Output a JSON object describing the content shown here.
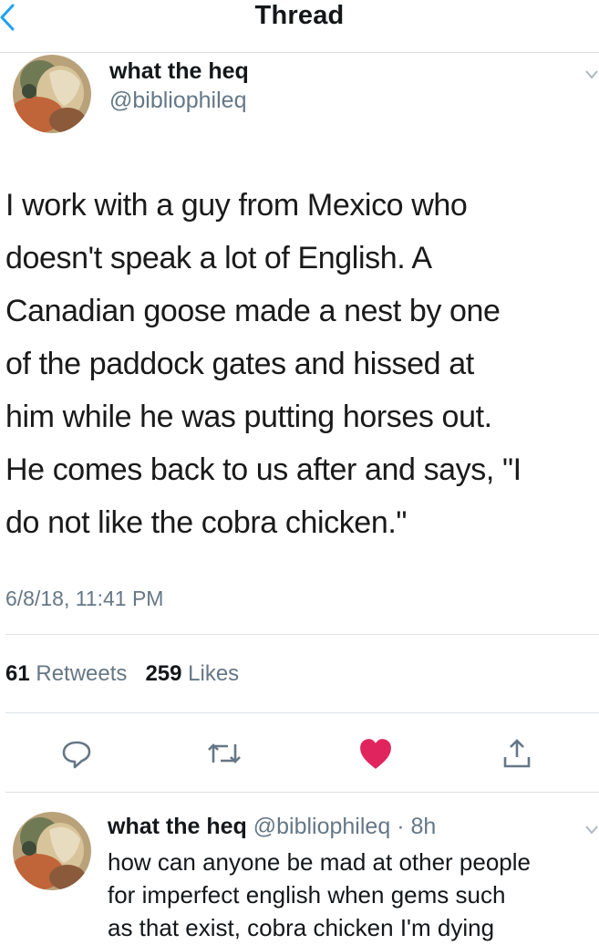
{
  "header": {
    "title": "Thread"
  },
  "tweet": {
    "name": "what the heq",
    "handle": "@bibliophileq",
    "body_lines": [
      "I work with a guy from Mexico who",
      "doesn't speak a lot of English. A",
      "Canadian goose made a nest by one",
      "of the paddock gates and hissed at",
      "him while he was putting horses out.",
      "He comes back to us after and says, \"I",
      "do not like the cobra chicken.\""
    ],
    "timestamp": "6/8/18, 11:41 PM",
    "retweets_count": "61",
    "retweets_label": "Retweets",
    "likes_count": "259",
    "likes_label": "Likes"
  },
  "actions": {
    "reply_icon": "reply-icon",
    "retweet_icon": "retweet-icon",
    "like_icon": "heart-icon",
    "share_icon": "share-icon",
    "like_color": "#e0245e",
    "icon_color": "#657786"
  },
  "reply": {
    "name": "what the heq",
    "handle": "@bibliophileq",
    "separator": "·",
    "time": "8h",
    "lines": [
      "how can anyone be mad at other people",
      "for imperfect english when gems such",
      "as that exist, cobra chicken I'm dying"
    ]
  }
}
